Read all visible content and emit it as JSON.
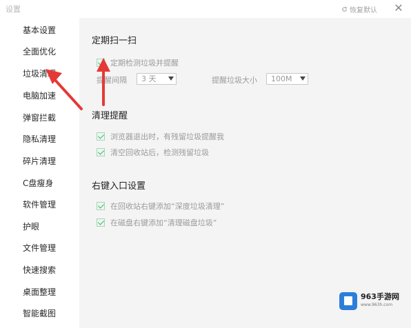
{
  "window": {
    "title": "设置",
    "restore_label": "恢复默认",
    "close_glyph": "✕"
  },
  "sidebar": {
    "items": [
      {
        "label": "基本设置"
      },
      {
        "label": "全面优化"
      },
      {
        "label": "垃圾清理"
      },
      {
        "label": "电脑加速"
      },
      {
        "label": "弹窗拦截"
      },
      {
        "label": "隐私清理"
      },
      {
        "label": "碎片清理"
      },
      {
        "label": "C盘瘦身"
      },
      {
        "label": "软件管理"
      },
      {
        "label": "护眼"
      },
      {
        "label": "文件管理"
      },
      {
        "label": "快速搜索"
      },
      {
        "label": "桌面整理"
      },
      {
        "label": "智能截图"
      }
    ],
    "active_index": 2
  },
  "sections": {
    "scheduled_scan": {
      "title": "定期扫一扫",
      "checkbox_label": "定期检测垃圾并提醒",
      "checked": true,
      "interval_label": "提醒间隔",
      "interval_value": "3 天",
      "size_label": "提醒垃圾大小",
      "size_value": "100M"
    },
    "cleanup_reminder": {
      "title": "清理提醒",
      "options": [
        {
          "label": "浏览器退出时，有残留垃圾提醒我",
          "checked": true
        },
        {
          "label": "清空回收站后，检测残留垃圾",
          "checked": true
        }
      ]
    },
    "context_menu": {
      "title": "右键入口设置",
      "options": [
        {
          "label": "在回收站右键添加“深度垃圾清理”",
          "checked": true
        },
        {
          "label": "在磁盘右键添加“清理磁盘垃圾”",
          "checked": true
        }
      ]
    }
  },
  "watermark": {
    "brand": "963手游网",
    "url": "www.963h.com"
  },
  "colors": {
    "arrow": "#e53935",
    "check_green": "#48b06c",
    "panel_bg": "#f4f4f4",
    "watermark_blue": "#2c7fd9"
  }
}
